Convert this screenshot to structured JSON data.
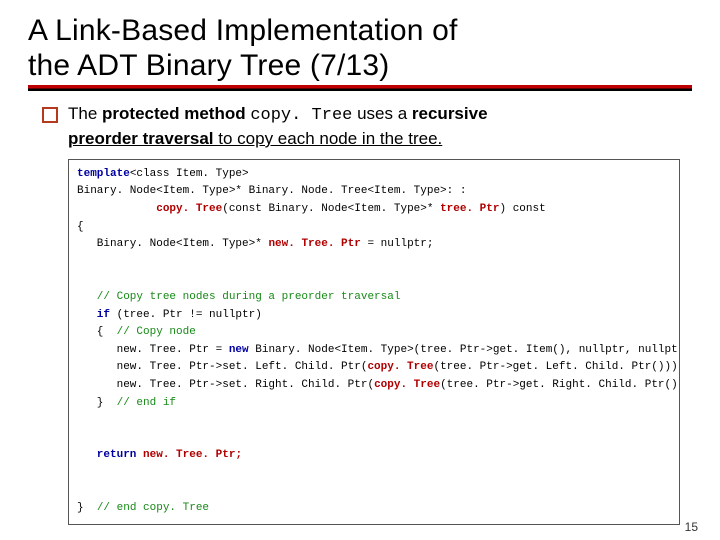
{
  "title_line1": "A Link-Based Implementation of",
  "title_line2": "the ADT Binary Tree (7/13)",
  "bullet": {
    "t1": "The ",
    "b1": "protected method ",
    "mono": "copy. Tree",
    "t2": " uses a ",
    "b2": "recursive",
    "b3": "preorder traversal",
    "t3": " to copy each node in the tree."
  },
  "code": {
    "l01a": "template",
    "l01b": "<class Item. Type>",
    "l02a": "Binary. Node<Item. Type>* Binary. Node. Tree<Item. Type>: :",
    "l03a": "            ",
    "l03b": "copy. Tree",
    "l03c": "(const Binary. Node<Item. Type>* ",
    "l03d": "tree. Ptr",
    "l03e": ") const",
    "l04": "{",
    "l05a": "   Binary. Node<Item. Type>* ",
    "l05b": "new. Tree. Ptr",
    "l05c": " = nullptr;",
    "blank1": " ",
    "blank2": " ",
    "l07": "   // Copy tree nodes during a preorder traversal",
    "l08a": "   if ",
    "l08b": "(tree. Ptr != nullptr)",
    "l09a": "   {  ",
    "l09b": "// Copy node",
    "l10a": "      new. Tree. Ptr = ",
    "l10b": "new",
    "l10c": " Binary. Node<Item. Type>(tree. Ptr->get. Item(), nullptr, nullptr);",
    "l11a": "      new. Tree. Ptr->set. Left. Child. Ptr(",
    "l11b": "copy. Tree",
    "l11c": "(tree. Ptr->get. Left. Child. Ptr()));",
    "l12a": "      new. Tree. Ptr->set. Right. Child. Ptr(",
    "l12b": "copy. Tree",
    "l12c": "(tree. Ptr->get. Right. Child. Ptr()));",
    "l13a": "   }  ",
    "l13b": "// end if",
    "blank3": " ",
    "blank4": " ",
    "l15a": "   return",
    "l15b": " new. Tree. Ptr;",
    "blank5": " ",
    "blank6": " ",
    "l17a": "}  ",
    "l17b": "// end copy. Tree"
  },
  "page_number": "15"
}
